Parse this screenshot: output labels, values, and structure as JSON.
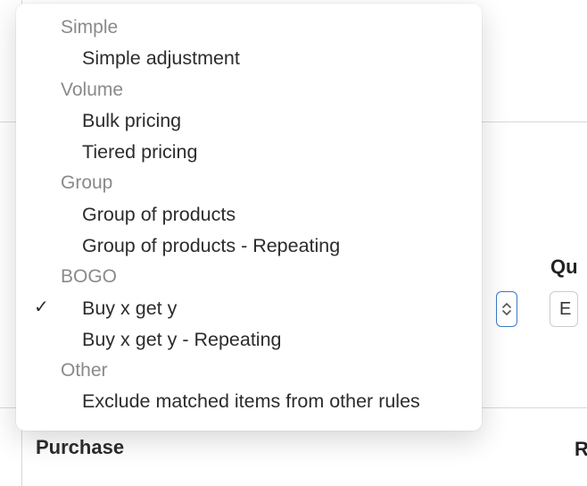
{
  "menu": {
    "groups": [
      {
        "label": "Simple",
        "items": [
          "Simple adjustment"
        ]
      },
      {
        "label": "Volume",
        "items": [
          "Bulk pricing",
          "Tiered pricing"
        ]
      },
      {
        "label": "Group",
        "items": [
          "Group of products",
          "Group of products - Repeating"
        ]
      },
      {
        "label": "BOGO",
        "items": [
          "Buy x get y",
          "Buy x get y - Repeating"
        ]
      },
      {
        "label": "Other",
        "items": [
          "Exclude matched items from other rules"
        ]
      }
    ],
    "selected": "Buy x get y",
    "checkmark": "✓"
  },
  "background": {
    "qty_label_partial": "Qu",
    "qty_field_value_partial": "E",
    "right_heading_partial": "R"
  },
  "section": {
    "purchase_heading": "Purchase"
  }
}
